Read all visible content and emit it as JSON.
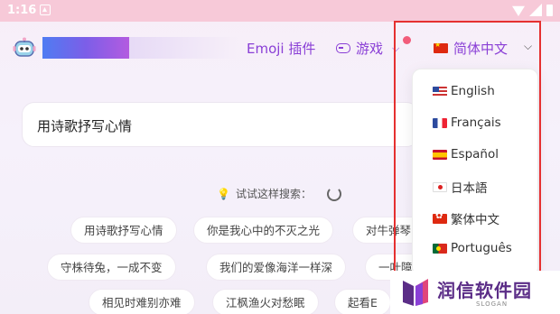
{
  "status_bar": {
    "time": "1:16"
  },
  "header": {
    "nav_emoji": "Emoji 插件",
    "nav_games": "游戏",
    "current_language": "简体中文"
  },
  "search": {
    "query": "用诗歌抒写心情"
  },
  "suggestions": {
    "title": "试试这样搜索：",
    "chips": [
      "用诗歌抒写心情",
      "你是我心中的不灭之光",
      "对牛弹琴",
      "守株待兔，一成不变",
      "我们的爱像海洋一样深",
      "一叶障",
      "相见时难别亦难",
      "江枫渔火对愁眠",
      "起看E"
    ]
  },
  "language_menu": {
    "items": [
      {
        "label": "English",
        "flag": "us-flag"
      },
      {
        "label": "Français",
        "flag": "fr-flag"
      },
      {
        "label": "Español",
        "flag": "es-flag"
      },
      {
        "label": "日本語",
        "flag": "jp-flag"
      },
      {
        "label": "繁体中文",
        "flag": "hk-flag"
      },
      {
        "label": "Português",
        "flag": "pt-flag"
      }
    ]
  },
  "watermark": {
    "name": "润信软件园",
    "slogan": "SLOGAN"
  },
  "colors": {
    "accent": "#8a3fd6",
    "highlight_border": "#e53030",
    "status_bar": "#f7c9d8",
    "watermark": "#5b2d87"
  }
}
